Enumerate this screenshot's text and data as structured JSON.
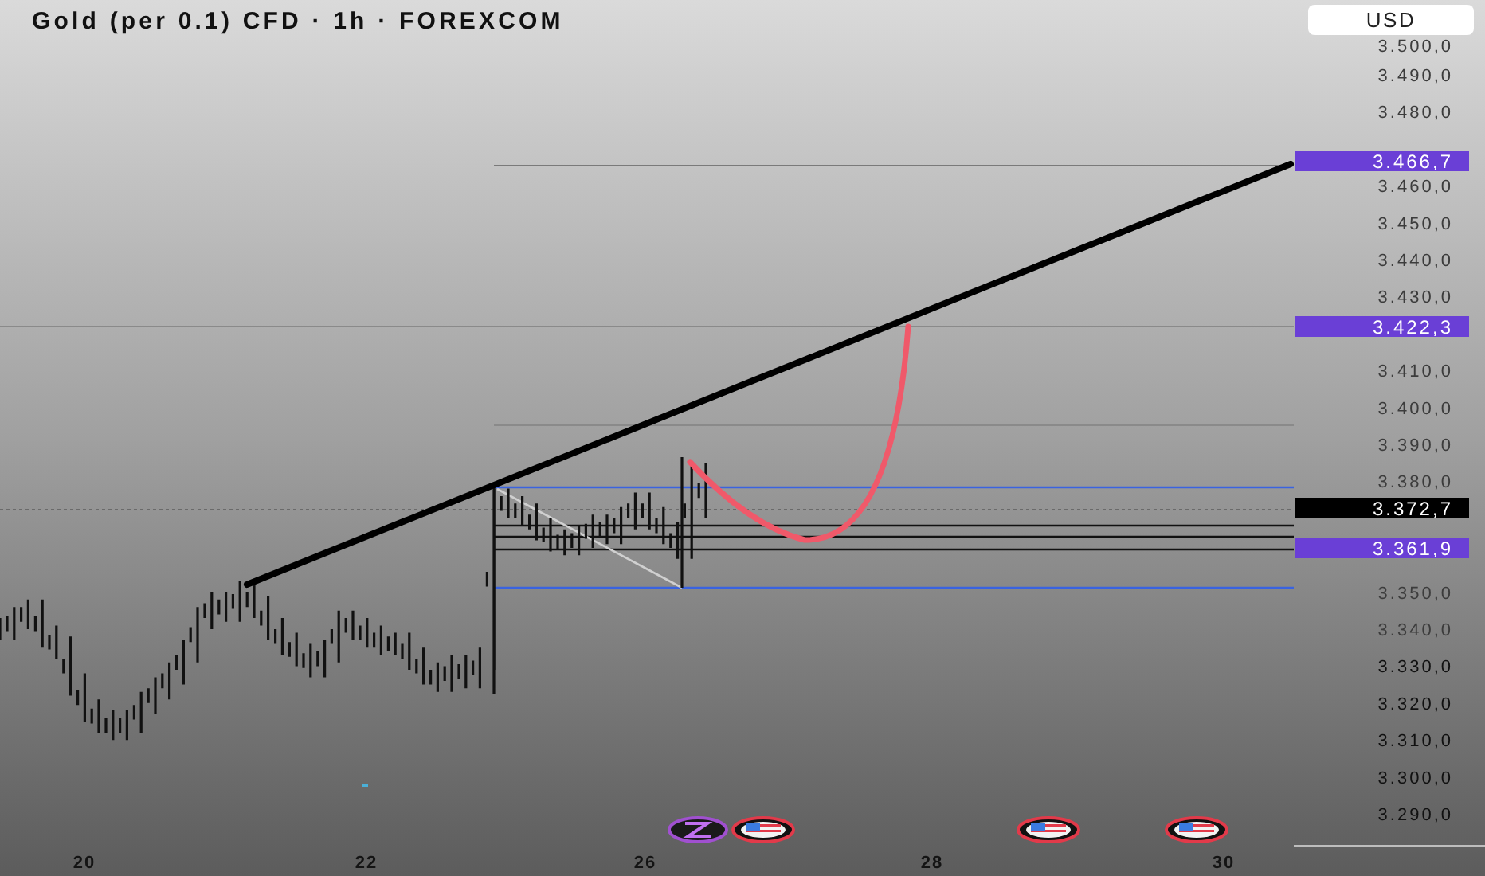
{
  "title": "Gold (per 0.1) CFD · 1h · FOREXCOM",
  "currency_button": "USD",
  "price_scale": [
    "3.500,0",
    "3.490,0",
    "3.480,0",
    "3.460,0",
    "3.450,0",
    "3.440,0",
    "3.430,0",
    "3.410,0",
    "3.400,0",
    "3.390,0",
    "3.380,0",
    "3.350,0",
    "3.340,0",
    "3.330,0",
    "3.320,0",
    "3.310,0",
    "3.300,0",
    "3.290,0"
  ],
  "date_scale": [
    "20",
    "22",
    "26",
    "28",
    "30"
  ],
  "price_labels": [
    {
      "text": "3.466,7",
      "color": "#6a3fd6"
    },
    {
      "text": "3.422,3",
      "color": "#6a3fd6"
    },
    {
      "text": "3.372,7",
      "color": "#000000"
    },
    {
      "text": "3.361,9",
      "color": "#6a3fd6"
    }
  ]
}
